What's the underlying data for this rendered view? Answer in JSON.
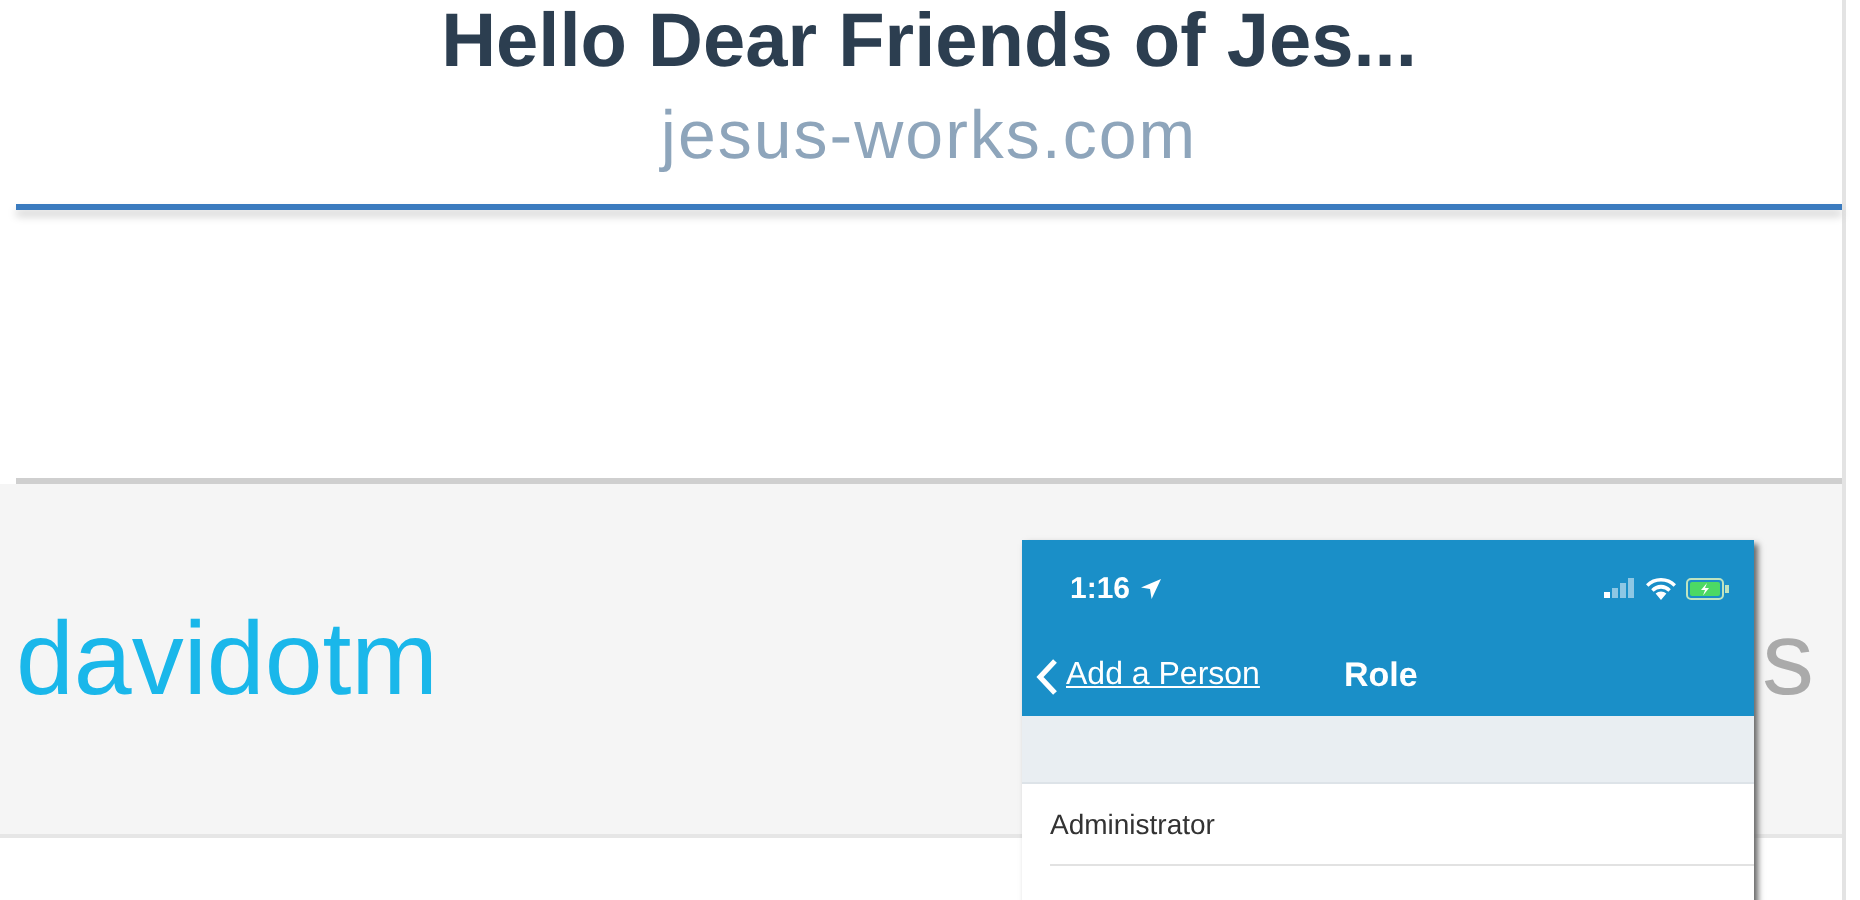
{
  "header": {
    "title": "Hello Dear Friends of Jes...",
    "domain": "jesus-works.com"
  },
  "profile_banner": {
    "handle": "davidotm",
    "trailing_text": "s"
  },
  "phone": {
    "status_bar": {
      "time": "1:16"
    },
    "nav_bar": {
      "back_label": "Add a Person",
      "title": "Role"
    },
    "list": [
      {
        "label": "Administrator"
      }
    ]
  }
}
